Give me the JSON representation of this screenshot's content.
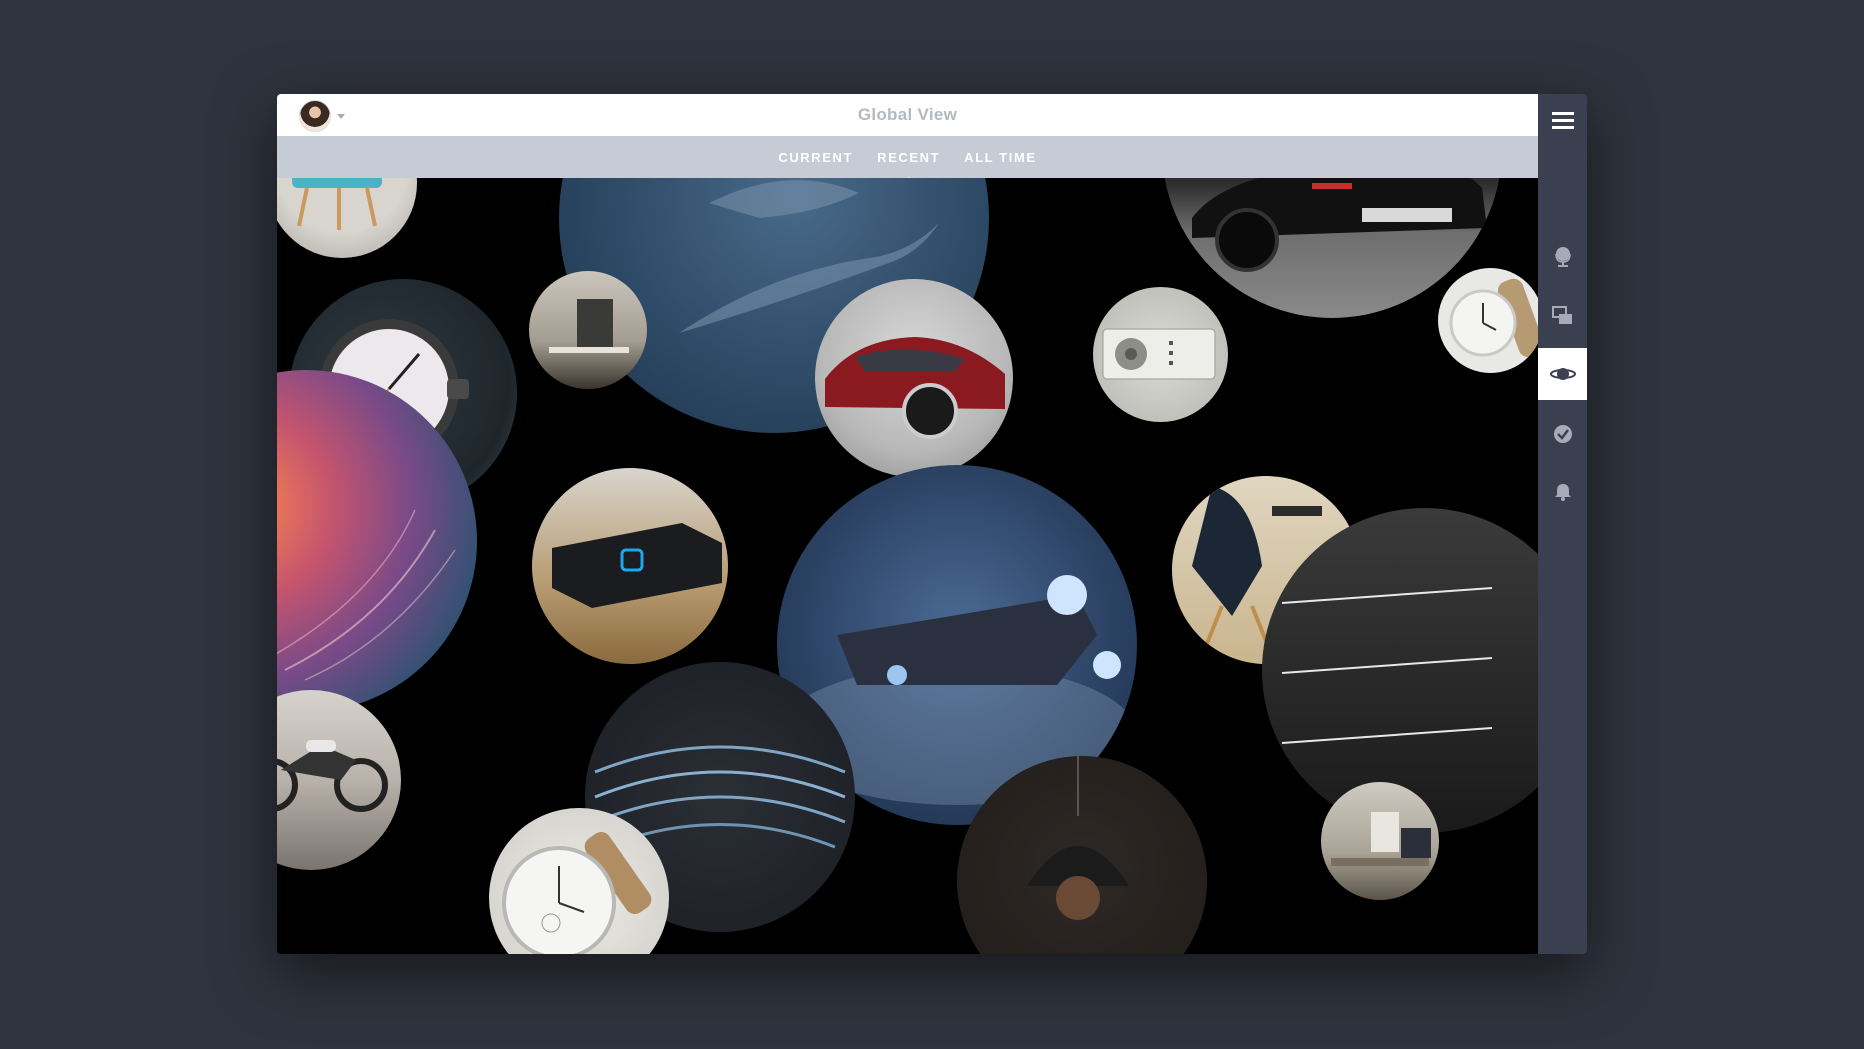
{
  "header": {
    "title": "Global View",
    "avatar_icon": "user-avatar"
  },
  "tabs": [
    {
      "label": "CURRENT",
      "active": false
    },
    {
      "label": "RECENT",
      "active": true
    },
    {
      "label": "ALL TIME",
      "active": false
    }
  ],
  "sidebar": {
    "items": [
      {
        "icon": "menu-icon",
        "active": false
      },
      {
        "icon": "globe-icon",
        "active": false
      },
      {
        "icon": "layers-icon",
        "active": false
      },
      {
        "icon": "planet-icon",
        "active": true
      },
      {
        "icon": "check-circle-icon",
        "active": false
      },
      {
        "icon": "bell-icon",
        "active": false
      }
    ]
  },
  "colors": {
    "page_background": "#2f333d",
    "tab_bar": "#c5ccd6",
    "sidebar": "#3b4050",
    "accent_red": "#e0374b"
  },
  "bubbles": [
    {
      "subject": "chair"
    },
    {
      "subject": "whale"
    },
    {
      "subject": "black-sports-car"
    },
    {
      "subject": "chronograph-watch"
    },
    {
      "subject": "interior-room"
    },
    {
      "subject": "red-sedan"
    },
    {
      "subject": "radio"
    },
    {
      "subject": "white-watch"
    },
    {
      "subject": "abstract-swirl"
    },
    {
      "subject": "streaming-box"
    },
    {
      "subject": "spaceship"
    },
    {
      "subject": "dining-chair"
    },
    {
      "subject": "staircase"
    },
    {
      "subject": "motorcycle"
    },
    {
      "subject": "stadium"
    },
    {
      "subject": "pendant-lamp"
    },
    {
      "subject": "wristwatch"
    },
    {
      "subject": "living-room"
    }
  ]
}
